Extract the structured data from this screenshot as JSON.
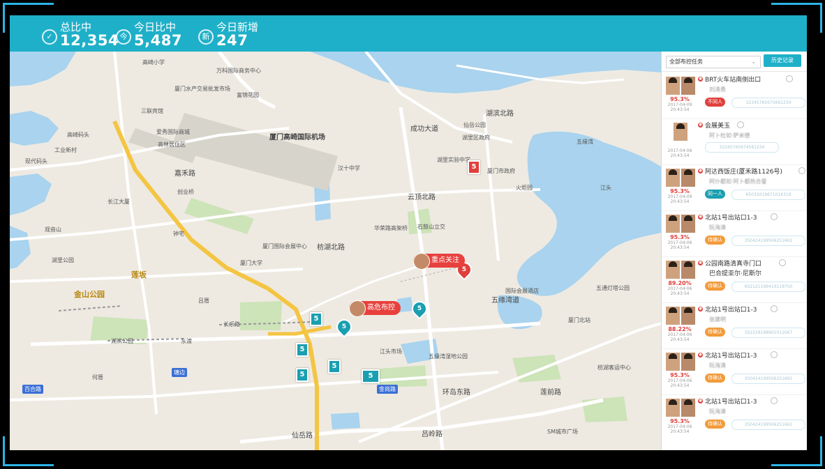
{
  "stats": [
    {
      "label": "总比中",
      "value": "12,354",
      "icon": "check-circle-icon"
    },
    {
      "label": "今日比中",
      "value": "5,487",
      "icon": "today-icon"
    },
    {
      "label": "今日新增",
      "value": "247",
      "icon": "add-icon"
    }
  ],
  "colors": {
    "accent": "#1fb0c9",
    "alert": "#e0403c",
    "frame": "#2bb4e6"
  },
  "sidebar": {
    "task_filter": "全部布控任务",
    "history_button": "历史记录",
    "alerts": [
      {
        "location": "BRT火车站南侧出口",
        "percent": "95.3%",
        "date": "2017-04-09",
        "time": "20:43:54",
        "name": "刘涛勇",
        "status": "不同人",
        "status_color": "#e0403c",
        "id": "32345765675661234"
      },
      {
        "location": "会展美玉",
        "percent": "",
        "date": "2017-04-06",
        "time": "20:43:54",
        "name": "阿卜杜如·萨米德",
        "status": "",
        "status_color": "",
        "id": "32345765674561234"
      },
      {
        "location": "阿达西饭庄(厦禾路1126号)",
        "percent": "95.3%",
        "date": "2017-04-09",
        "time": "20:43:54",
        "name": "阿仆都如·阿卜都热合曼",
        "status": "同一人",
        "status_color": "#1a9fb0",
        "id": "65032019671014319"
      },
      {
        "location": "北站1号出站口1-3",
        "percent": "95.3%",
        "date": "2017-04-06",
        "time": "20:43:54",
        "name": "阮海清",
        "status": "待确认",
        "status_color": "#f29b3a",
        "id": "350424199506251661"
      },
      {
        "location": "公园南路清真寺门口",
        "percent": "89.20%",
        "date": "2017-04-06",
        "time": "20:43:54",
        "name": "巴合提亚尔·尼斯尔",
        "status": "待确认",
        "status_color": "#f29b3a",
        "id": "652121199410119750"
      },
      {
        "location": "北站1号出站口1-3",
        "percent": "88.22%",
        "date": "2017-04-06",
        "time": "20:43:54",
        "name": "张建明",
        "status": "待确认",
        "status_color": "#f29b3a",
        "id": "352229198901012067"
      },
      {
        "location": "北站1号出站口1-3",
        "percent": "95.3%",
        "date": "2017-04-06",
        "time": "20:43:54",
        "name": "阮海清",
        "status": "待确认",
        "status_color": "#f29b3a",
        "id": "350424199506251661"
      },
      {
        "location": "北站1号出站口1-3",
        "percent": "95.3%",
        "date": "2017-04-06",
        "time": "20:43:54",
        "name": "阮海清",
        "status": "待确认",
        "status_color": "#f29b3a",
        "id": "350424199506251661"
      }
    ]
  },
  "map": {
    "airport": "厦门高崎国际机场",
    "roads": [
      "湖滨北路",
      "仙岳路",
      "五缘湾道",
      "吕岭路",
      "云顶北路",
      "枋湖北路",
      "成功大道",
      "嘉禾路",
      "环岛东路",
      "金尚路",
      "莲前路"
    ],
    "places": [
      "高崎小学",
      "厦门水产交易批发市场",
      "万科国际商务中心",
      "富锦花园",
      "三联宾馆",
      "爱秀国际商城",
      "工业新村",
      "高崎码头",
      "高林居住区",
      "现代码头",
      "仙岳公园",
      "湖里区政府",
      "五缘湾",
      "湖里实验中学",
      "汉十中学",
      "厦门市政府",
      "火炬园",
      "江头",
      "创业桥",
      "长江大厦",
      "华荣路高架桥",
      "石鼓山立交",
      "观音山",
      "钟宅",
      "厦门国际会展中心",
      "厦门大学",
      "湖里公园",
      "金山公园",
      "莲坂",
      "吕厝",
      "长乐路",
      "东渡",
      "湖滨公园",
      "何厝",
      "江头市场",
      "五缘湾湿地公园",
      "国际会展酒店",
      "五通灯塔公园",
      "厦门北站",
      "枋湖客运中心",
      "SM城市广场"
    ],
    "bubbles": [
      "重点关注",
      "高危布控"
    ],
    "tags": [
      "百合路",
      "塘边",
      "金尚路"
    ]
  }
}
